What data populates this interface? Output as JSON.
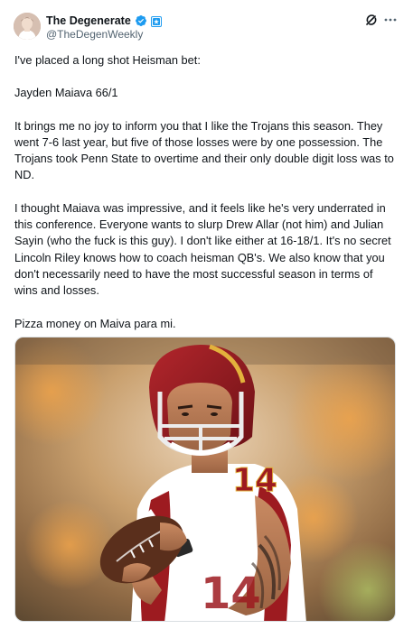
{
  "author": {
    "display_name": "The Degenerate",
    "handle": "@TheDegenWeekly"
  },
  "icons": {
    "verified": "verified-badge-icon",
    "affiliate": "affiliate-badge-icon",
    "grok": "grok-icon",
    "more": "more-options-icon"
  },
  "colors": {
    "verified_blue": "#1d9bf0",
    "text_primary": "#0f1419",
    "text_secondary": "#536471",
    "jersey_red": "#9d1b20",
    "helmet_gold": "#e3b23c"
  },
  "tweet": {
    "paragraphs": [
      "I've placed a long shot Heisman bet:",
      "Jayden Maiava 66/1",
      "It brings me no joy to inform you that I like the Trojans this season. They went 7-6 last year, but five of those losses were by one possession. The Trojans took Penn State to overtime and their only double digit loss was to ND.",
      "I thought Maiava was impressive, and it feels like he's very underrated in this conference. Everyone wants to slurp Drew Allar (not him) and Julian Sayin (who the fuck is this guy). I don't like either at 16-18/1. It's no secret Lincoln Riley knows how to coach heisman QB's. We also know that you don't necessarily need to have the most successful season in terms of wins and losses.",
      "Pizza money on Maiva para mi."
    ],
    "media_jersey_number": "14"
  }
}
